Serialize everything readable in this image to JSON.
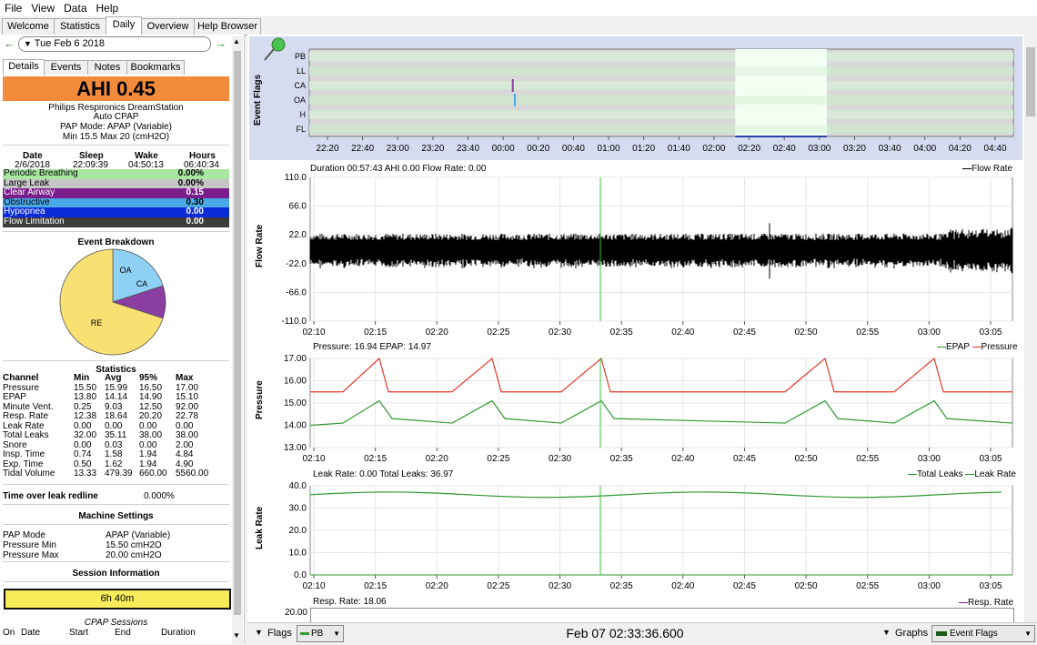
{
  "menu": [
    "File",
    "View",
    "Data",
    "Help"
  ],
  "top_tabs": [
    "Welcome",
    "Statistics",
    "Daily",
    "Overview",
    "Help Browser"
  ],
  "active_top_tab": "Daily",
  "date_nav": {
    "date": "Tue Feb 6 2018"
  },
  "sub_tabs": [
    "Details",
    "Events",
    "Notes",
    "Bookmarks"
  ],
  "ahi": "AHI 0.45",
  "machine": {
    "name": "Philips Respironics DreamStation",
    "type": "Auto CPAP",
    "mode": "PAP Mode: APAP (Variable)",
    "range": "Min 15.5 Max 20 (cmH2O)"
  },
  "session_summary": {
    "headers": [
      "Date",
      "Sleep",
      "Wake",
      "Hours"
    ],
    "values": [
      "2/6/2018",
      "22:09:39",
      "04:50:13",
      "06:40:34"
    ]
  },
  "event_rates": [
    {
      "label": "Periodic Breathing",
      "value": "0.00%",
      "color": "#a8e6a1",
      "text": "#000"
    },
    {
      "label": "Large Leak",
      "value": "0.00%",
      "color": "#c6c6c6",
      "text": "#000"
    },
    {
      "label": "Clear Airway",
      "value": "0.15",
      "color": "#7a1e8c",
      "text": "#fff"
    },
    {
      "label": "Obstructive",
      "value": "0.30",
      "color": "#4aa9e6",
      "text": "#000"
    },
    {
      "label": "Hypopnea",
      "value": "0.00",
      "color": "#0a2bd8",
      "text": "#fff"
    },
    {
      "label": "Flow Limitation",
      "value": "0.00",
      "color": "#3c3c3c",
      "text": "#fff"
    }
  ],
  "breakdown": {
    "title": "Event Breakdown",
    "slices": [
      {
        "label": "OA",
        "fraction": 0.2,
        "color": "#8fd0f5"
      },
      {
        "label": "CA",
        "fraction": 0.1,
        "color": "#8a3ea0"
      },
      {
        "label": "RE",
        "fraction": 0.7,
        "color": "#f9e073"
      }
    ]
  },
  "statistics": {
    "title": "Statistics",
    "headers": [
      "Channel",
      "Min",
      "Avg",
      "95%",
      "Max"
    ],
    "rows": [
      [
        "Pressure",
        "15.50",
        "15.99",
        "16.50",
        "17.00"
      ],
      [
        "EPAP",
        "13.80",
        "14.14",
        "14.90",
        "15.10"
      ],
      [
        "Minute Vent.",
        "0.25",
        "9.03",
        "12.50",
        "92.00"
      ],
      [
        "Resp. Rate",
        "12.38",
        "18.64",
        "20.20",
        "22.78"
      ],
      [
        "Leak Rate",
        "0.00",
        "0.00",
        "0.00",
        "0.00"
      ],
      [
        "Total Leaks",
        "32.00",
        "35.11",
        "38.00",
        "38.00"
      ],
      [
        "Snore",
        "0.00",
        "0.03",
        "0.00",
        "2.00"
      ],
      [
        "Insp. Time",
        "0.74",
        "1.58",
        "1.94",
        "4.84"
      ],
      [
        "Exp. Time",
        "0.50",
        "1.62",
        "1.94",
        "4.90"
      ],
      [
        "Tidal Volume",
        "13.33",
        "479.39",
        "660.00",
        "5560.00"
      ]
    ]
  },
  "leak_redline": {
    "label": "Time over leak redline",
    "value": "0.000%"
  },
  "machine_settings": {
    "title": "Machine Settings",
    "rows": [
      [
        "PAP Mode",
        "APAP (Variable)"
      ],
      [
        "Pressure Min",
        "15.50 cmH2O"
      ],
      [
        "Pressure Max",
        "20.00 cmH2O"
      ]
    ]
  },
  "session_info": {
    "title": "Session Information",
    "bar": "6h 40m",
    "cpap_label": "CPAP Sessions",
    "headers": [
      "On",
      "Date",
      "Start",
      "End",
      "Duration"
    ]
  },
  "event_flags": {
    "ylabel": "Event Flags",
    "rows": [
      "PB",
      "LL",
      "CA",
      "OA",
      "H",
      "FL"
    ],
    "ticks": [
      "22:20",
      "22:40",
      "23:00",
      "23:20",
      "23:40",
      "00:00",
      "00:20",
      "00:40",
      "01:00",
      "01:20",
      "01:40",
      "02:00",
      "02:20",
      "02:40",
      "03:00",
      "03:20",
      "03:40",
      "04:00",
      "04:20",
      "04:40"
    ],
    "events": [
      {
        "type": "CA",
        "t": 0.289,
        "color": "#8a3ea0"
      },
      {
        "type": "OA",
        "t": 0.292,
        "color": "#4aa9e6"
      }
    ],
    "window": [
      0.605,
      0.735
    ]
  },
  "flow_graph": {
    "info": "Duration 00:57:43 AHI 0.00 Flow Rate: 0.00",
    "legend": "Flow Rate",
    "ylabel": "Flow Rate",
    "yticks": [
      "110.0",
      "66.0",
      "22.0",
      "-22.0",
      "-66.0",
      "-110.0"
    ],
    "ylim": [
      -110,
      110
    ]
  },
  "time_ticks": [
    "02:10",
    "02:15",
    "02:20",
    "02:25",
    "02:30",
    "02:35",
    "02:40",
    "02:45",
    "02:50",
    "02:55",
    "03:00",
    "03:05"
  ],
  "pressure_graph": {
    "info": "Pressure: 16.94 EPAP: 14.97",
    "legend": [
      "EPAP",
      "Pressure"
    ],
    "legend_colors": [
      "#2f9a2f",
      "#e03a2a"
    ],
    "ylabel": "Pressure",
    "yticks": [
      "17.00",
      "16.00",
      "15.00",
      "14.00",
      "13.00"
    ],
    "ylim": [
      13,
      17
    ]
  },
  "leak_graph": {
    "info": "Leak Rate: 0.00 Total Leaks: 36.97",
    "legend": [
      "Total Leaks",
      "Leak Rate"
    ],
    "legend_colors": [
      "#2f9a2f",
      "#2f9a2f"
    ],
    "ylabel": "Leak Rate",
    "yticks": [
      "40.0",
      "30.0",
      "20.0",
      "10.0",
      "0.0"
    ],
    "ylim": [
      0,
      40
    ]
  },
  "resp_graph": {
    "info": "Resp. Rate: 18.06",
    "legend": "Resp. Rate",
    "ytick": "20.00"
  },
  "bottom_bar": {
    "flags_label": "Flags",
    "flags_select": "PB",
    "timestamp": "Feb 07 02:33:36.600",
    "graphs_label": "Graphs",
    "graphs_select": "Event Flags"
  }
}
